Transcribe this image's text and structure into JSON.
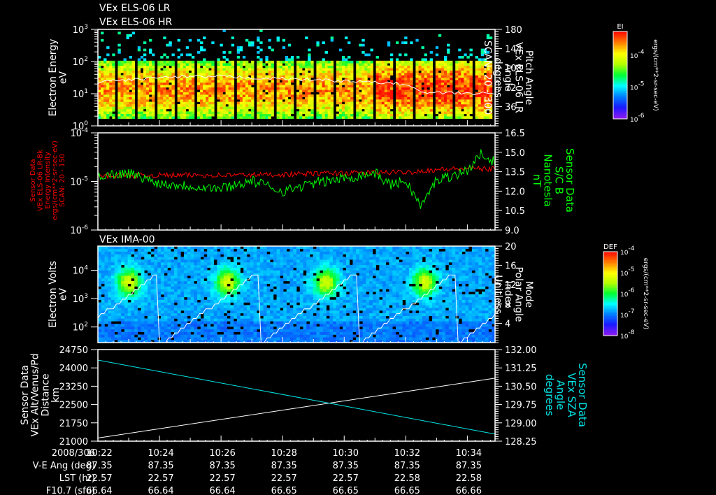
{
  "chart_data": [
    {
      "type": "heatmap",
      "id": "els-spectrogram",
      "titles": [
        "VEx ELS-06 LR",
        "VEx ELS-06 HR"
      ],
      "ylabel": [
        "Electron Energy",
        "eV"
      ],
      "yticks": [
        "10^0",
        "10^1",
        "10^2",
        "10^3"
      ],
      "ylim_log": [
        0,
        3
      ],
      "y2label": [
        "Pitch Angle",
        "VEx ELS-06 LR",
        "Angle",
        "degrees",
        "SCAN: 20 - 300"
      ],
      "y2ticks": [
        36,
        72,
        108,
        144,
        180
      ],
      "y2lim": [
        0,
        180
      ],
      "line_series": {
        "name": "Pitch Angle",
        "color": "#ffffff",
        "minutes": [
          0,
          2,
          4,
          6,
          8,
          10,
          10.5,
          12.9
        ],
        "values": [
          82,
          90,
          92,
          88,
          84,
          78,
          62,
          60
        ]
      },
      "colorbar": {
        "label": "EI",
        "ticks": [
          "10^-4",
          "10^-5",
          "10^-6"
        ],
        "units": "ergs/(cm**2-sr-sec-eV)"
      }
    },
    {
      "type": "line",
      "id": "els-b-field",
      "ylabel": [
        "Sensor Data",
        "VEx ELS-06 LR-Bk",
        "Energy Intensity",
        "ergs/(cm**2-sr-sec-eV)",
        "SCAN: 20 - 150"
      ],
      "yticks": [
        "10^-6",
        "10^-5",
        "10^-4"
      ],
      "ylim_log": [
        -6,
        -4
      ],
      "y2label": [
        "Sensor Data",
        "S/C B",
        "Nanotesla",
        "nT"
      ],
      "y2ticks": [
        "9.0",
        "10.5",
        "12.0",
        "13.5",
        "15.0",
        "16.5"
      ],
      "y2lim": [
        9,
        16.5
      ],
      "series": [
        {
          "name": "Energy Intensity",
          "color": "#ff0000",
          "axis": "left",
          "minutes": [
            0,
            2,
            4,
            6,
            8,
            10,
            11,
            12,
            12.9
          ],
          "values": [
            1.3e-05,
            1.35e-05,
            1.35e-05,
            1.4e-05,
            1.5e-05,
            1.55e-05,
            1.75e-05,
            1.85e-05,
            1.8e-05
          ]
        },
        {
          "name": "S/C B",
          "color": "#00ff00",
          "axis": "right",
          "minutes": [
            0,
            1,
            2,
            3,
            4,
            5,
            6,
            7,
            8,
            9,
            9.5,
            10,
            10.5,
            11,
            11.5,
            12,
            12.5,
            12.9
          ],
          "values": [
            13.2,
            13.4,
            12.6,
            12.4,
            12.2,
            12.8,
            12.0,
            12.6,
            13.0,
            13.4,
            12.5,
            12.8,
            10.8,
            12.9,
            13.2,
            13.6,
            15.0,
            14.2
          ]
        }
      ]
    },
    {
      "type": "heatmap",
      "id": "ima-spectrogram",
      "title": "VEx IMA-00",
      "ylabel": [
        "Electron Volts",
        "eV"
      ],
      "yticks": [
        "10^2",
        "10^3",
        "10^4"
      ],
      "y2label": [
        "Mode",
        "Polar Angle",
        "Index",
        "Unitless"
      ],
      "y2ticks": [
        4,
        8,
        12,
        16,
        20
      ],
      "y2lim": [
        0,
        20
      ],
      "line_series": {
        "name": "Polar Angle Index",
        "color": "#ffffff",
        "period_minutes": 3.2,
        "max": 15
      },
      "colorbar": {
        "label": "DEF",
        "ticks": [
          "10^-4",
          "10^-5",
          "10^-6",
          "10^-7",
          "10^-8"
        ],
        "units": "ergs/(cm**2-sr-sec-eV)"
      }
    },
    {
      "type": "line",
      "id": "orbit",
      "ylabel": [
        "Sensor Data",
        "VEx Alt/Venus/Pd",
        "Distance",
        "km"
      ],
      "yticks": [
        "21000",
        "21750",
        "22500",
        "23250",
        "24000",
        "24750"
      ],
      "ylim": [
        21000,
        24750
      ],
      "y2label": [
        "Sensor Data",
        "VEx SZA",
        "Angle",
        "degrees"
      ],
      "y2ticks": [
        "128.25",
        "129.00",
        "129.75",
        "130.50",
        "131.25",
        "132.00"
      ],
      "y2lim": [
        128.25,
        132
      ],
      "series": [
        {
          "name": "Altitude",
          "color": "#ffffff",
          "axis": "left",
          "minutes": [
            0,
            12.9
          ],
          "values": [
            21130,
            23580
          ]
        },
        {
          "name": "SZA",
          "color": "#00e5e5",
          "axis": "right",
          "minutes": [
            0,
            12.9
          ],
          "values": [
            131.57,
            128.54
          ]
        }
      ]
    }
  ],
  "xaxis": {
    "date": "2008/306",
    "rows": [
      {
        "label": "V-E Ang (deg)",
        "values": [
          "87.35",
          "87.35",
          "87.35",
          "87.35",
          "87.35",
          "87.35",
          "87.35"
        ]
      },
      {
        "label": "LST (hr)",
        "values": [
          "22.57",
          "22.57",
          "22.57",
          "22.57",
          "22.57",
          "22.58",
          "22.58"
        ]
      },
      {
        "label": "F10.7 (sfu)",
        "values": [
          "66.64",
          "66.64",
          "66.64",
          "66.65",
          "66.65",
          "66.65",
          "66.66"
        ]
      }
    ],
    "ticks": [
      "10:22",
      "10:24",
      "10:26",
      "10:28",
      "10:30",
      "10:32",
      "10:34"
    ],
    "range_minutes": [
      0,
      12.9
    ]
  }
}
